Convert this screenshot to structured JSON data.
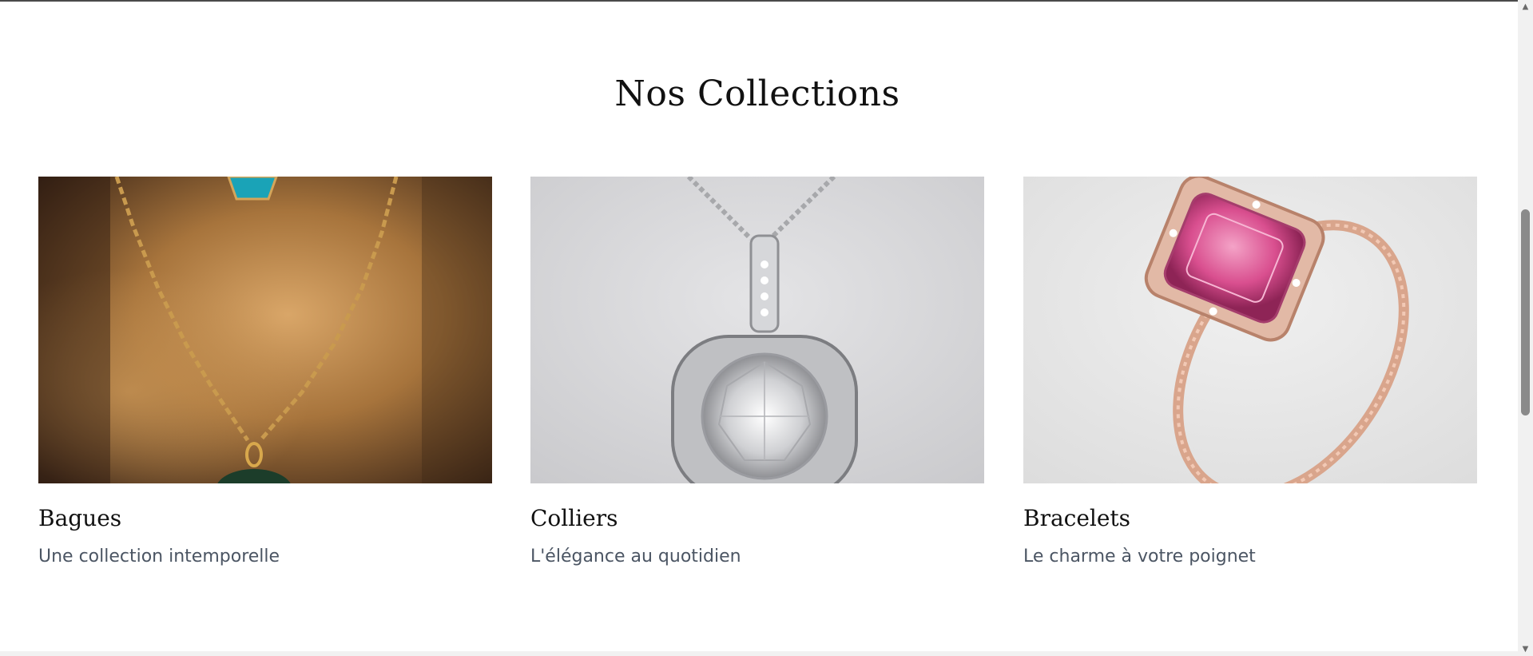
{
  "section": {
    "title": "Nos Collections"
  },
  "collections": [
    {
      "title": "Bagues",
      "subtitle": "Une collection intemporelle",
      "image_icon": "necklace-chain-photo"
    },
    {
      "title": "Colliers",
      "subtitle": "L'élégance au quotidien",
      "image_icon": "diamond-pendant-photo"
    },
    {
      "title": "Bracelets",
      "subtitle": "Le charme à votre poignet",
      "image_icon": "pink-gem-ring-photo"
    }
  ],
  "scrollbar": {
    "up_icon": "▲",
    "down_icon": "▼"
  },
  "colors": {
    "title": "#111111",
    "subtitle": "#4b5563",
    "background": "#ffffff"
  }
}
